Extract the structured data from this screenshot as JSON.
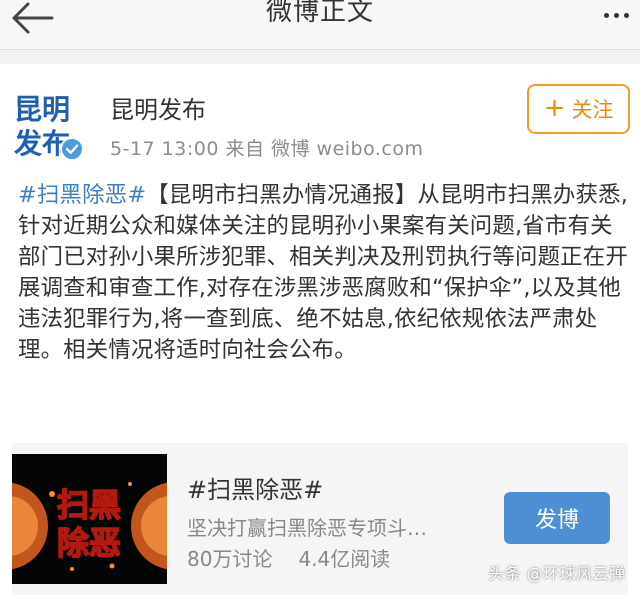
{
  "header": {
    "title": "微博正文"
  },
  "account": {
    "name": "昆明发布",
    "avatar_text": [
      "昆明",
      "发布"
    ],
    "meta": "5-17 13:00  来自 微博 weibo.com"
  },
  "follow_button": {
    "plus": "+",
    "label": "关注"
  },
  "post": {
    "hashtag": "#扫黑除恶#",
    "body": "【昆明市扫黑办情况通报】从昆明市扫黑办获悉,针对近期公众和媒体关注的昆明孙小果案有关问题,省市有关部门已对孙小果所涉犯罪、相关判决及刑罚执行等问题正在开展调查和审查工作,对存在涉黑涉恶腐败和“保护伞”,以及其他违法犯罪行为,将一查到底、绝不姑息,依纪依规依法严肃处理。相关情况将适时向社会公布。"
  },
  "topic": {
    "image_text": [
      "扫黑",
      "除恶"
    ],
    "title": "#扫黑除恶#",
    "description": "坚决打赢扫黑除恶专项斗…",
    "discussions": "80万讨论",
    "reads": "4.4亿阅读",
    "post_button": "发博"
  },
  "watermark": "头条 @环球风云弹",
  "colors": {
    "link": "#3f7fc1",
    "follow": "#ec8a10",
    "button": "#4e8fd3"
  }
}
